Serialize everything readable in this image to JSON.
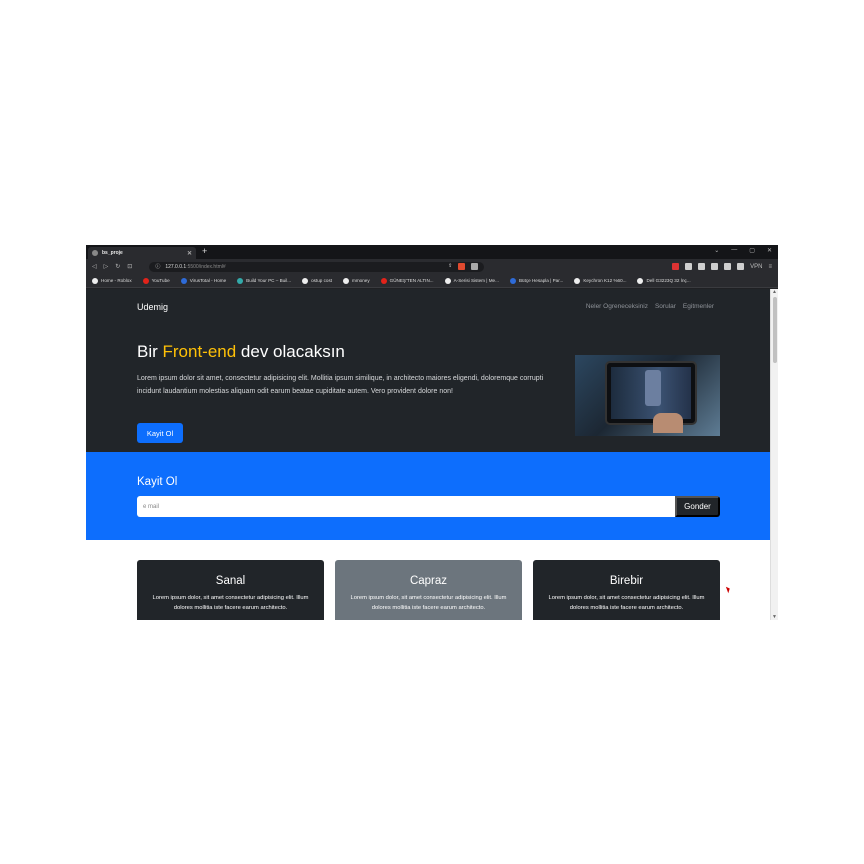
{
  "browser": {
    "tab_title": "bs_proje",
    "tab_close": "✕",
    "new_tab": "+",
    "window_controls": [
      "⌄",
      "—",
      "▢",
      "✕"
    ],
    "nav": {
      "back": "◁",
      "forward": "▷",
      "reload": "↻",
      "bookmark": "⊡"
    },
    "url_host": "127.0.0.1",
    "url_rest": ":5500/index.html#",
    "vpn_label": "VPN",
    "menu_icon": "≡",
    "bookmarks": [
      {
        "label": "Home - Roblox",
        "icon": "white"
      },
      {
        "label": "YouTube",
        "icon": "red"
      },
      {
        "label": "VirusTotal - Home",
        "icon": "blue"
      },
      {
        "label": "Build Your PC – Buil...",
        "icon": "teal"
      },
      {
        "label": "ostup cost",
        "icon": "white"
      },
      {
        "label": "mmoney",
        "icon": "white"
      },
      {
        "label": "GÜNEŞ'TEN ALTIN...",
        "icon": "red"
      },
      {
        "label": "A-Serisi Sistem | Me...",
        "icon": "white"
      },
      {
        "label": "Bütçe Hesapla | Par...",
        "icon": "blue"
      },
      {
        "label": "Keychron K12 %60...",
        "icon": "white"
      },
      {
        "label": "Dell G3223Q 32 İnç...",
        "icon": "white"
      }
    ]
  },
  "site": {
    "brand": "Udemig",
    "menu": [
      "Neler Ogreneceksiniz",
      "Sorular",
      "Egitmenler"
    ],
    "hero": {
      "title_before": "Bir ",
      "title_highlight": "Front-end",
      "title_after": " dev olacaksın",
      "text": "Lorem ipsum dolor sit amet, consectetur adipisicing elit. Mollitia ipsum similique, in architecto maiores eligendi, doloremque corrupti incidunt laudantium molestias aliquam odit earum beatae cupiditate autem. Vero provident dolore non!",
      "button": "Kayit Ol"
    },
    "signup": {
      "title": "Kayit Ol",
      "placeholder": "e mail",
      "button": "Gonder"
    },
    "cards": [
      {
        "title": "Sanal",
        "text": "Lorem ipsum dolor, sit amet consectetur adipisicing elit. Illum dolores mollitia iste facere earum architecto."
      },
      {
        "title": "Capraz",
        "text": "Lorem ipsum dolor, sit amet consectetur adipisicing elit. Illum dolores mollitia iste facere earum architecto."
      },
      {
        "title": "Birebir",
        "text": "Lorem ipsum dolor, sit amet consectetur adipisicing elit. Illum dolores mollitia iste facere earum architecto."
      }
    ]
  },
  "colors": {
    "dark": "#212529",
    "primary": "#0d6efd",
    "accent": "#ffc107",
    "gray": "#6c757d"
  }
}
